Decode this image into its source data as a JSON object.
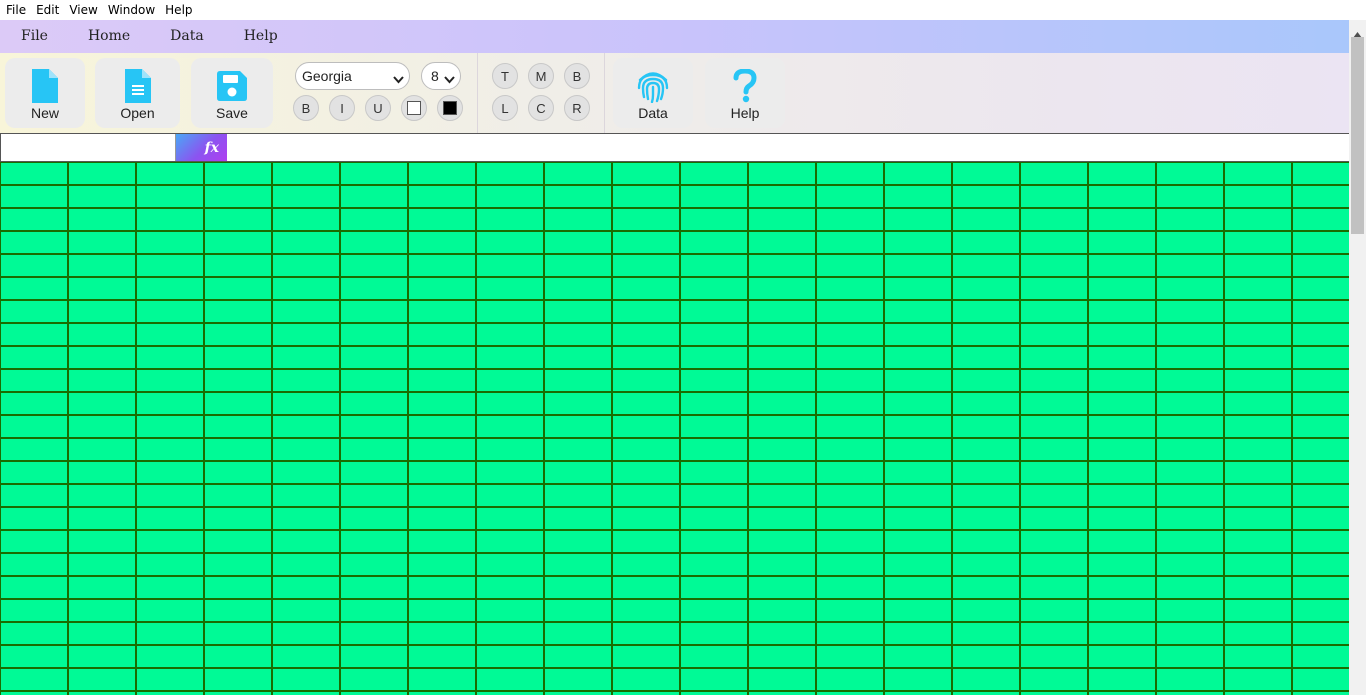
{
  "menubar": {
    "items": [
      {
        "label": "File"
      },
      {
        "label": "Edit"
      },
      {
        "label": "View"
      },
      {
        "label": "Window"
      },
      {
        "label": "Help"
      }
    ]
  },
  "ribbon": {
    "tabs": [
      {
        "label": "File"
      },
      {
        "label": "Home"
      },
      {
        "label": "Data"
      },
      {
        "label": "Help"
      }
    ]
  },
  "toolbar": {
    "new_label": "New",
    "open_label": "Open",
    "save_label": "Save",
    "font_family": "Georgia",
    "font_size": "8",
    "style_buttons": {
      "bold": "B",
      "italic": "I",
      "underline": "U"
    },
    "background_color": "#ffffff",
    "text_color": "#000000",
    "vertical_align": {
      "top": "T",
      "middle": "M",
      "bottom": "B"
    },
    "horizontal_align": {
      "left": "L",
      "center": "C",
      "right": "R"
    },
    "data_label": "Data",
    "help_label": "Help",
    "icon_color": "#27c5f5"
  },
  "formula_bar": {
    "fx_label": "fx",
    "cell_ref_value": "",
    "formula_value": ""
  },
  "grid": {
    "cell_color": "#00fa96",
    "border_color": "#1a6c00"
  }
}
